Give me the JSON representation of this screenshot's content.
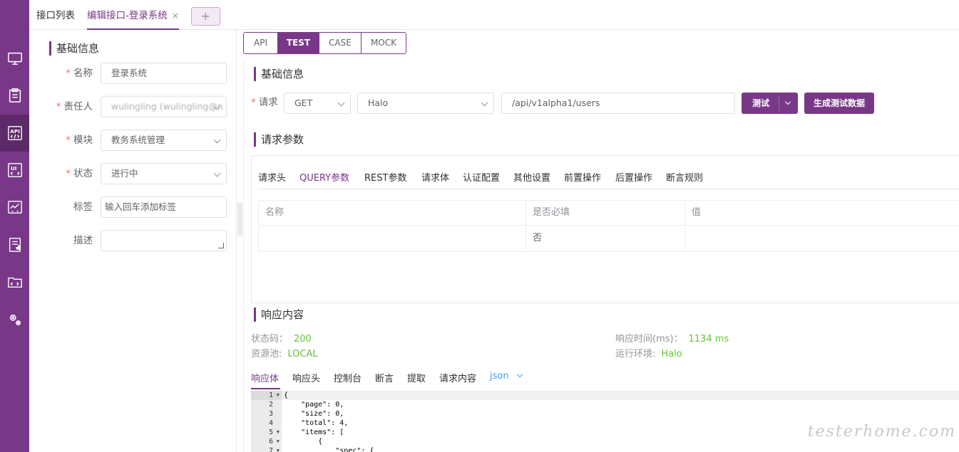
{
  "top_tabs": {
    "list_label": "接口列表",
    "edit_label": "编辑接口-登录系统",
    "close_glyph": "×",
    "add_glyph": "+"
  },
  "left_form": {
    "title": "基础信息",
    "name_label": "名称",
    "name_value": "登录系统",
    "owner_label": "责任人",
    "owner_value": "wulingling (wulingling@n",
    "module_label": "模块",
    "module_value": "教务系统管理",
    "status_label": "状态",
    "status_value": "进行中",
    "tags_label": "标签",
    "tags_placeholder": "输入回车添加标签",
    "desc_label": "描述",
    "desc_value": "",
    "required_mark": "*"
  },
  "mode_tabs": [
    "API",
    "TEST",
    "CASE",
    "MOCK"
  ],
  "basic": {
    "title": "基础信息",
    "request_label": "请求",
    "method": "GET",
    "env": "Halo",
    "url": "/api/v1alpha1/users",
    "test_button": "测试",
    "generate_button": "生成测试数据"
  },
  "params": {
    "title": "请求参数",
    "tabs": [
      "请求头",
      "QUERY参数",
      "REST参数",
      "请求体",
      "认证配置",
      "其他设置",
      "前置操作",
      "后置操作",
      "断言规则"
    ],
    "active_tab": "QUERY参数",
    "columns": [
      "名称",
      "是否必填",
      "值"
    ],
    "rows": [
      {
        "name": "",
        "required": "否",
        "value": ""
      }
    ]
  },
  "response": {
    "title": "响应内容",
    "status_label": "状态码：",
    "status_value": "200",
    "pool_label": "资源池:",
    "pool_value": "LOCAL",
    "time_label": "响应时间(ms)：",
    "time_value": "1134 ms",
    "env_label": "运行环境:",
    "env_value": "Halo",
    "tabs": [
      "响应体",
      "响应头",
      "控制台",
      "断言",
      "提取",
      "请求内容"
    ],
    "format": "json",
    "body_lines": [
      "{",
      "    \"page\": 0,",
      "    \"size\": 0,",
      "    \"total\": 4,",
      "    \"items\": [",
      "        {",
      "            \"spec\": {"
    ],
    "line_numbers": [
      "1",
      "2",
      "3",
      "4",
      "5",
      "6",
      "7"
    ]
  },
  "watermark": "testerhome.com",
  "colors": {
    "primary": "#783887",
    "success": "#67c23a",
    "danger": "#f56c6c",
    "link": "#409eff"
  },
  "rail_icons": [
    "monitor-icon",
    "clipboard-icon",
    "api-icon",
    "ui-icon",
    "chart-icon",
    "report-icon",
    "folder-icon",
    "settings-icon"
  ]
}
